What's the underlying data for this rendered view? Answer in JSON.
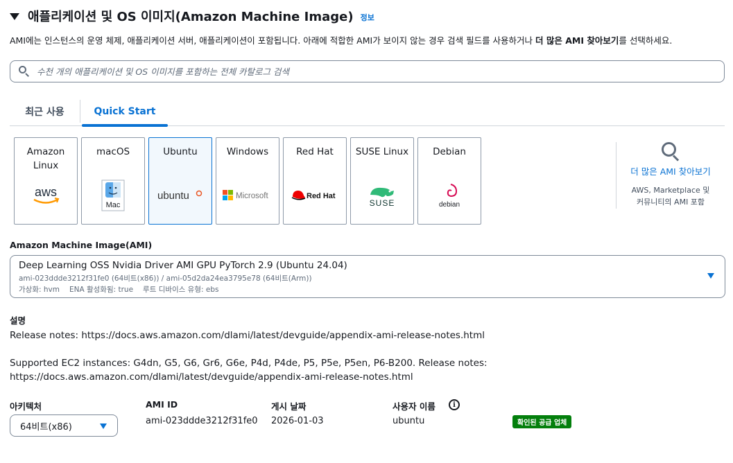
{
  "header": {
    "title": "애플리케이션 및 OS 이미지(Amazon Machine Image)",
    "info": "정보"
  },
  "description": {
    "prefix": "AMI에는 인스턴스의 운영 체제, 애플리케이션 서버, 애플리케이션이 포함됩니다. 아래에 적합한 AMI가 보이지 않는 경우 검색 필드를 사용하거나 ",
    "bold": "더 많은 AMI 찾아보기",
    "suffix": "를 선택하세요."
  },
  "search": {
    "placeholder": "수천 개의 애플리케이션 및 OS 이미지를 포함하는 전체 카탈로그 검색",
    "value": ""
  },
  "tabs": [
    {
      "label": "최근 사용",
      "active": false
    },
    {
      "label": "Quick Start",
      "active": true
    }
  ],
  "os_tiles": [
    {
      "label": "Amazon Linux",
      "icon": "aws-logo",
      "logo_text": "aws",
      "selected": false
    },
    {
      "label": "macOS",
      "icon": "mac-finder-logo",
      "logo_text": "Mac",
      "selected": false
    },
    {
      "label": "Ubuntu",
      "icon": "ubuntu-logo",
      "logo_text": "ubuntu",
      "selected": true
    },
    {
      "label": "Windows",
      "icon": "microsoft-logo",
      "logo_text": "Microsoft",
      "selected": false
    },
    {
      "label": "Red Hat",
      "icon": "redhat-logo",
      "logo_text": "Red Hat",
      "selected": false
    },
    {
      "label": "SUSE Linux",
      "icon": "suse-logo",
      "logo_text": "SUSE",
      "selected": false
    },
    {
      "label": "Debian",
      "icon": "debian-logo",
      "logo_text": "debian",
      "selected": false
    }
  ],
  "browse_more": {
    "icon": "search-icon",
    "label": "더 많은 AMI 찾아보기",
    "sub_line1": "AWS, Marketplace 및",
    "sub_line2": "커뮤니티의 AMI 포함"
  },
  "ami": {
    "label": "Amazon Machine Image(AMI)",
    "name": "Deep Learning OSS Nvidia Driver AMI GPU PyTorch 2.9 (Ubuntu 24.04)",
    "ids": "ami-023ddde3212f31fe0 (64비트(x86)) / ami-05d2da24ea3795e78 (64비트(Arm))",
    "virtualization": "가상화: hvm",
    "ena": "ENA 활성화됨: true",
    "root_device": "루트 디바이스 유형: ebs"
  },
  "details": {
    "label": "설명",
    "line1": "Release notes: https://docs.aws.amazon.com/dlami/latest/devguide/appendix-ami-release-notes.html",
    "line2": "Supported EC2 instances: G4dn, G5, G6, Gr6, G6e, P4d, P4de, P5, P5e, P5en, P6-B200. Release notes:",
    "line3": "https://docs.aws.amazon.com/dlami/latest/devguide/appendix-ami-release-notes.html"
  },
  "footer": {
    "arch_label": "아키텍처",
    "arch_value": "64비트(x86)",
    "ami_id_label": "AMI ID",
    "ami_id_value": "ami-023ddde3212f31fe0",
    "date_label": "게시 날짜",
    "date_value": "2026-01-03",
    "user_label": "사용자 이름",
    "user_value": "ubuntu",
    "info_icon": "i",
    "badge": "확인된 공급 업체"
  },
  "colors": {
    "accent": "#0972d3",
    "badge": "#037f0c",
    "text": "#16191f"
  }
}
